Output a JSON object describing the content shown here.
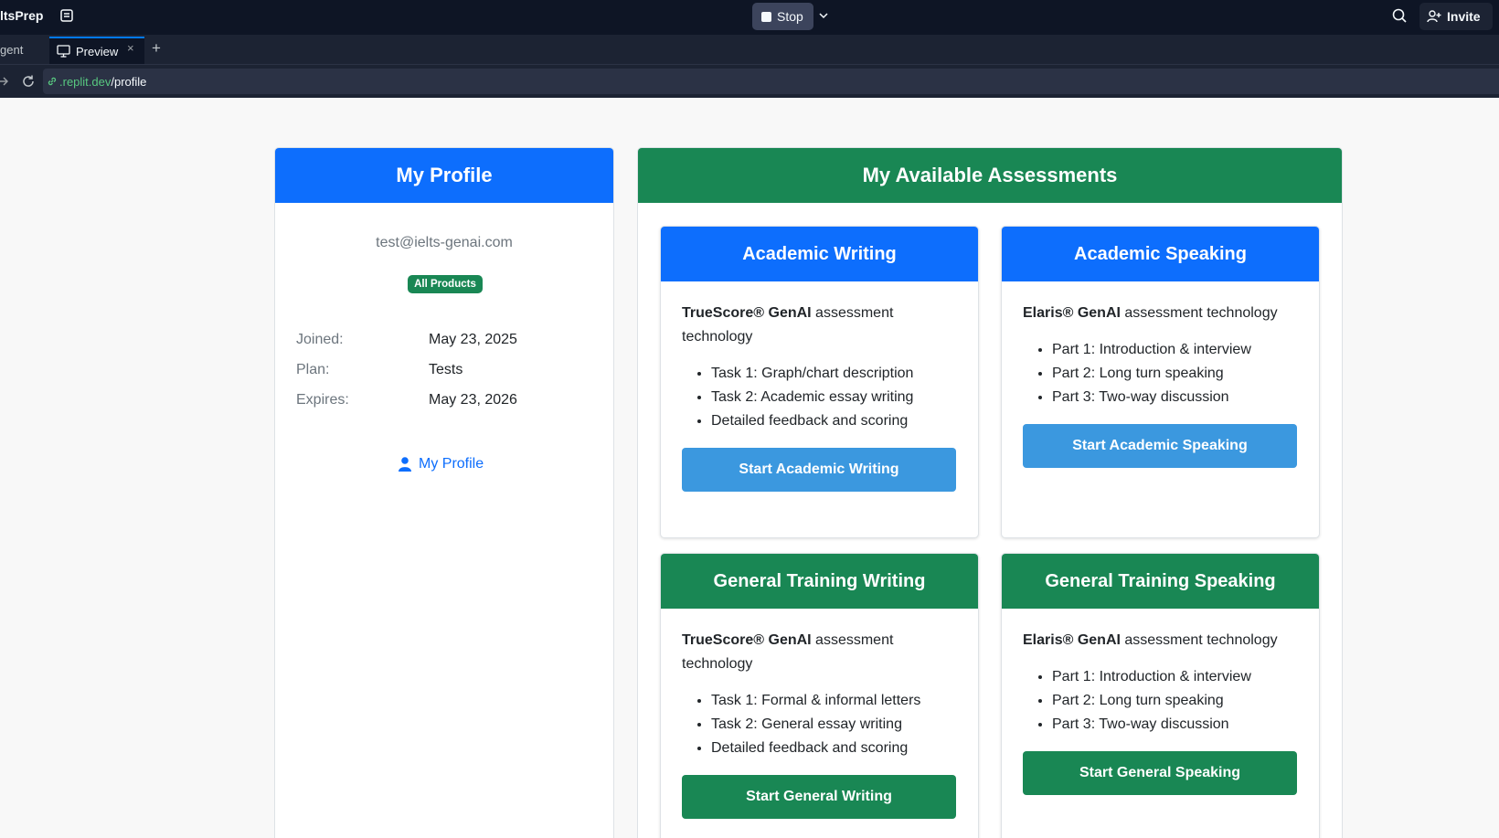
{
  "replit": {
    "app_name": "ltsPrep",
    "stop_label": "Stop",
    "invite_label": "Invite",
    "tab_agent": "gent",
    "tab_preview": "Preview",
    "tab_close": "×",
    "tab_add": "+",
    "url_host": ".replit.dev",
    "url_path": "/profile"
  },
  "profile": {
    "header": "My Profile",
    "email": "test@ielts-genai.com",
    "badge": "All Products",
    "rows": [
      {
        "label": "Joined:",
        "value": "May 23, 2025"
      },
      {
        "label": "Plan:",
        "value": "Tests"
      },
      {
        "label": "Expires:",
        "value": "May 23, 2026"
      }
    ],
    "link_label": "My Profile"
  },
  "assessments": {
    "header": "My Available Assessments",
    "cards": [
      {
        "title": "Academic Writing",
        "brand": "TrueScore® GenAI",
        "tech": " assessment technology",
        "items": [
          "Task 1: Graph/chart description",
          "Task 2: Academic essay writing",
          "Detailed feedback and scoring"
        ],
        "button": "Start Academic Writing"
      },
      {
        "title": "Academic Speaking",
        "brand": "Elaris® GenAI",
        "tech": " assessment technology",
        "items": [
          "Part 1: Introduction & interview",
          "Part 2: Long turn speaking",
          "Part 3: Two-way discussion"
        ],
        "button": "Start Academic Speaking"
      },
      {
        "title": "General Training Writing",
        "brand": "TrueScore® GenAI",
        "tech": " assessment technology",
        "items": [
          "Task 1: Formal & informal letters",
          "Task 2: General essay writing",
          "Detailed feedback and scoring"
        ],
        "button": "Start General Writing"
      },
      {
        "title": "General Training Speaking",
        "brand": "Elaris® GenAI",
        "tech": " assessment technology",
        "items": [
          "Part 1: Introduction & interview",
          "Part 2: Long turn speaking",
          "Part 3: Two-way discussion"
        ],
        "button": "Start General Speaking"
      }
    ]
  },
  "colors": {
    "blue": "#0d6efd",
    "green": "#198754",
    "light_blue_button": "#3b98df",
    "replit_dark": "#0e1525"
  }
}
